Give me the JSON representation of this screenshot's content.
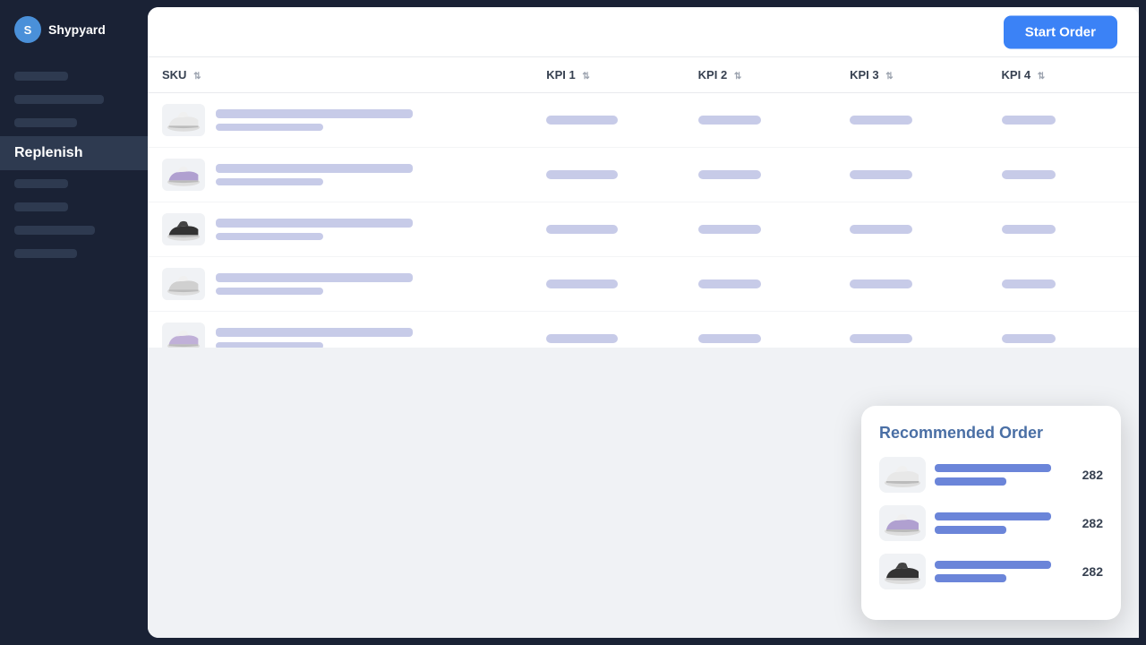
{
  "app": {
    "name": "Shypyard",
    "logo_letter": "S"
  },
  "sidebar": {
    "nav_items": [
      {
        "id": "item1",
        "label": "",
        "active": false,
        "skeleton": true,
        "sk_class": "sk-s1"
      },
      {
        "id": "item2",
        "label": "",
        "active": false,
        "skeleton": true,
        "sk_class": "sk-s2"
      },
      {
        "id": "item3",
        "label": "",
        "active": false,
        "skeleton": true,
        "sk_class": "sk-s3"
      },
      {
        "id": "replenish",
        "label": "Replenish",
        "active": true,
        "skeleton": false
      },
      {
        "id": "item5",
        "label": "",
        "active": false,
        "skeleton": true,
        "sk_class": "sk-s1"
      },
      {
        "id": "item6",
        "label": "",
        "active": false,
        "skeleton": true,
        "sk_class": "sk-s1"
      },
      {
        "id": "item7",
        "label": "",
        "active": false,
        "skeleton": true,
        "sk_class": "sk-s4"
      },
      {
        "id": "item8",
        "label": "",
        "active": false,
        "skeleton": true,
        "sk_class": "sk-s3"
      }
    ]
  },
  "header": {
    "start_order_label": "Start Order"
  },
  "table": {
    "columns": [
      {
        "id": "sku",
        "label": "SKU",
        "sortable": true
      },
      {
        "id": "kpi1",
        "label": "KPI 1",
        "sortable": true
      },
      {
        "id": "kpi2",
        "label": "KPI 2",
        "sortable": true
      },
      {
        "id": "kpi3",
        "label": "KPI 3",
        "sortable": true
      },
      {
        "id": "kpi4",
        "label": "KPI 4",
        "sortable": true
      }
    ],
    "rows": [
      {
        "id": "row1",
        "shoe_color": "white",
        "sku_w": "220",
        "sku_sw": "120"
      },
      {
        "id": "row2",
        "shoe_color": "purple",
        "sku_w": "220",
        "sku_sw": "120"
      },
      {
        "id": "row3",
        "shoe_color": "black",
        "sku_w": "220",
        "sku_sw": "120"
      },
      {
        "id": "row4",
        "shoe_color": "white-grey",
        "sku_w": "220",
        "sku_sw": "120"
      },
      {
        "id": "row5",
        "shoe_color": "purple-light",
        "sku_w": "220",
        "sku_sw": "120"
      },
      {
        "id": "row6",
        "shoe_color": "black",
        "sku_w": "190",
        "sku_sw": "100"
      }
    ]
  },
  "recommended_order": {
    "title": "Recommended Order",
    "items": [
      {
        "id": "rec1",
        "shoe_color": "white",
        "qty": 282
      },
      {
        "id": "rec2",
        "shoe_color": "purple",
        "qty": 282
      },
      {
        "id": "rec3",
        "shoe_color": "black",
        "qty": 282
      }
    ]
  }
}
